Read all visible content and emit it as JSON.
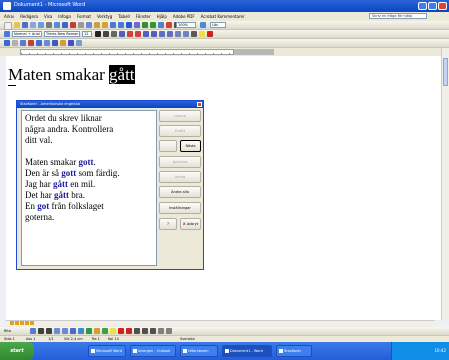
{
  "window": {
    "title": "Dokument1 - Microsoft Word"
  },
  "menu": {
    "items": [
      "Arkiv",
      "Redigera",
      "Visa",
      "Infoga",
      "Format",
      "Verktyg",
      "Tabell",
      "Fönster",
      "Hjälp",
      "Adobe PDF",
      "Acrobat Kommentarer"
    ],
    "ask_placeholder": "Skriv en fråga för hjälp"
  },
  "formatting": {
    "style": "Normal + Arial",
    "font": "Times New Roman",
    "size": "12",
    "zoom": "100%",
    "read": "Läs"
  },
  "document": {
    "text_before": "Maten smakar ",
    "highlighted_word": "gått"
  },
  "dialog": {
    "title": "StavKontr - Amerikanska engelska",
    "intro_lines": [
      "Ordet du skrev liknar",
      "några andra. Kontrollera",
      "ditt val."
    ],
    "sentences": [
      {
        "before": "Maten smakar ",
        "word": "gott",
        "after": "."
      },
      {
        "before": "Den är så ",
        "word": "gott",
        "after": " som färdig."
      },
      {
        "before": "Jag har ",
        "word": "gått",
        "after": " en mil."
      },
      {
        "before": "Det har ",
        "word": "gått",
        "after": " bra."
      },
      {
        "before": "En ",
        "word": "got",
        "after": " från folkslaget"
      }
    ],
    "last_line": "goterna.",
    "buttons": {
      "b1": "Lyssna",
      "b2": "Ersätt",
      "b3": "Nästa",
      "b4": "Ignorera",
      "b5": "Ändra",
      "b6": "Ändra alla",
      "b7": "Inställningar",
      "help": "?",
      "close_x": "X",
      "close": "Avbryt"
    }
  },
  "statusbar": {
    "page": "Sida 1",
    "section": "Avs 1",
    "pages": "1/1",
    "position": "Vid 2,4 cm",
    "line": "Ra 1",
    "column": "Kol 14",
    "language": "Svenska"
  },
  "drawbar": {
    "label": "Rita"
  },
  "taskbar": {
    "start": "start",
    "tasks": [
      "Microsoft Word",
      "Inkorgen - Outlook",
      "Utforskaren",
      "Dokument1 - Word",
      "StavKontr"
    ],
    "time": "10:42"
  },
  "colors": {
    "accent_blue": "#0a46c4",
    "suggestion_word": "#1a1aa0",
    "cancel_red": "#d21010",
    "taskbar": "#245edb",
    "start_green": "#3a9a3a"
  }
}
